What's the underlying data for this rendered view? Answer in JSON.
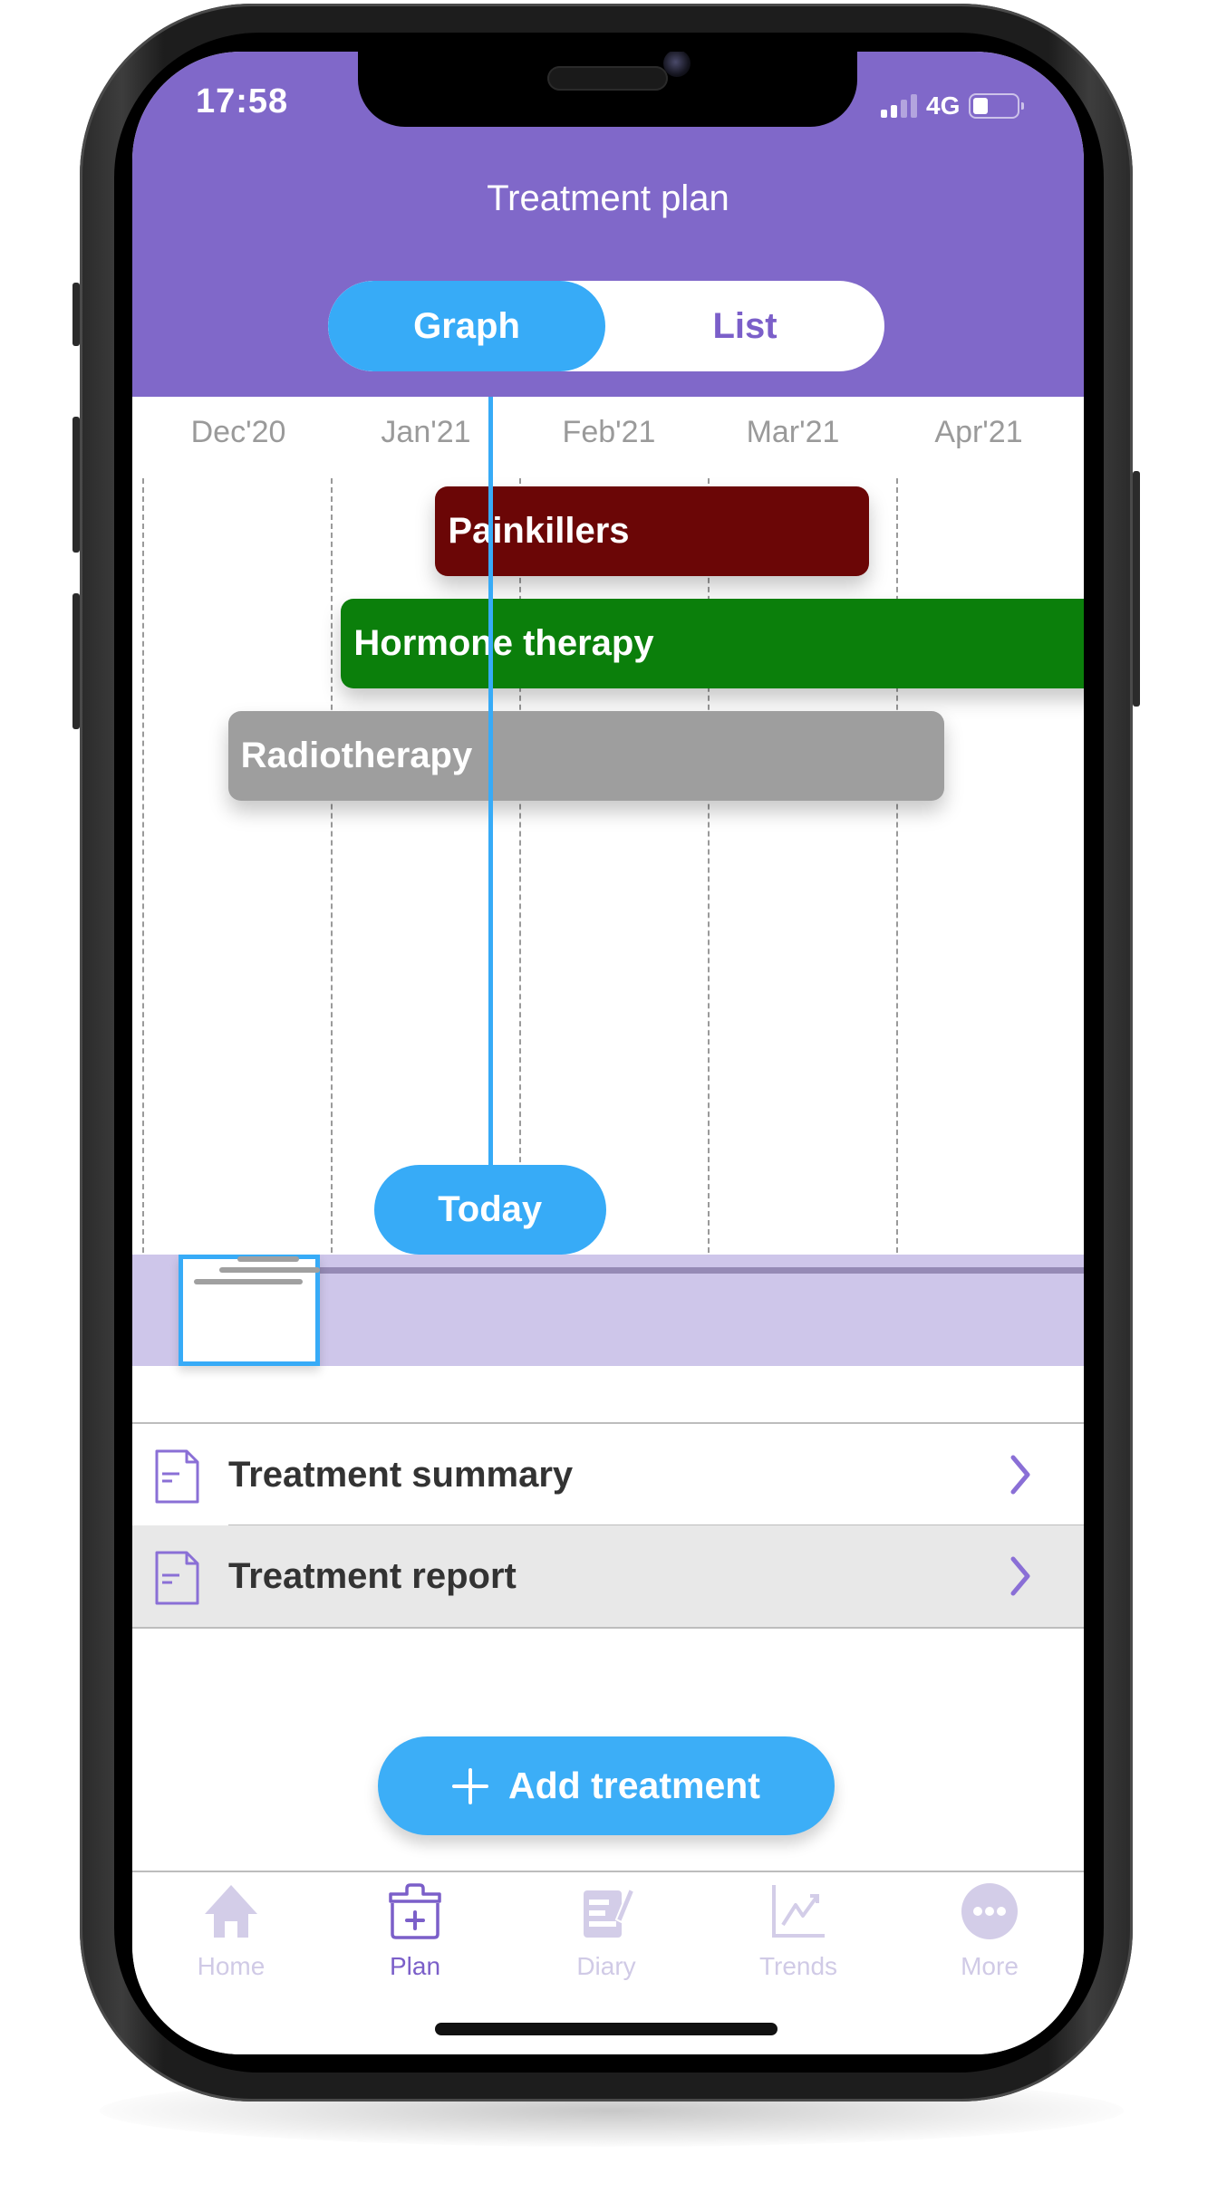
{
  "status_bar": {
    "time": "17:58",
    "network": "4G",
    "signal_bars": 2,
    "signal_bars_total": 4,
    "battery_level": 0.25
  },
  "header": {
    "title": "Treatment plan",
    "view_toggle": {
      "options": [
        "Graph",
        "List"
      ],
      "selected": "Graph"
    }
  },
  "colors": {
    "header_purple": "#8068c9",
    "accent_blue": "#37abf7",
    "painkillers": "#6b0606",
    "hormone_therapy": "#0b7f0b",
    "radiotherapy": "#9e9e9e",
    "minimap": "#cec6ea",
    "active_tab": "#7b5fc9",
    "inactive_tab": "#d0cae6"
  },
  "chart_data": {
    "type": "gantt",
    "x_axis_unit": "month",
    "x_range_months": [
      "2020-11",
      "2021-05"
    ],
    "tick_labels": [
      "Dec'20",
      "Jan'21",
      "Feb'21",
      "Mar'21",
      "Apr'21"
    ],
    "grid": "dashed vertical month boundaries",
    "today_marker": {
      "label": "Today",
      "position_months_from_dec20": 1.84
    },
    "tasks": [
      {
        "name": "Painkillers",
        "start_months_from_dec20": 1.55,
        "end_months_from_dec20": 3.85,
        "color": "#6b0606"
      },
      {
        "name": "Hormone therapy",
        "start_months_from_dec20": 1.05,
        "end_months_from_dec20": 5.0,
        "color": "#0b7f0b",
        "continues_beyond_view": true
      },
      {
        "name": "Radiotherapy",
        "start_months_from_dec20": 0.45,
        "end_months_from_dec20": 4.25,
        "color": "#9e9e9e"
      }
    ]
  },
  "minimap": {
    "window_fraction_start": 0.05,
    "window_fraction_end": 0.2
  },
  "links": [
    {
      "label": "Treatment summary",
      "icon": "document-icon"
    },
    {
      "label": "Treatment report",
      "icon": "document-icon"
    }
  ],
  "actions": {
    "add_treatment": "Add treatment"
  },
  "tab_bar": {
    "items": [
      {
        "label": "Home",
        "icon": "home-icon",
        "active": false
      },
      {
        "label": "Plan",
        "icon": "medical-kit-icon",
        "active": true
      },
      {
        "label": "Diary",
        "icon": "diary-icon",
        "active": false
      },
      {
        "label": "Trends",
        "icon": "trends-icon",
        "active": false
      },
      {
        "label": "More",
        "icon": "more-icon",
        "active": false
      }
    ]
  }
}
